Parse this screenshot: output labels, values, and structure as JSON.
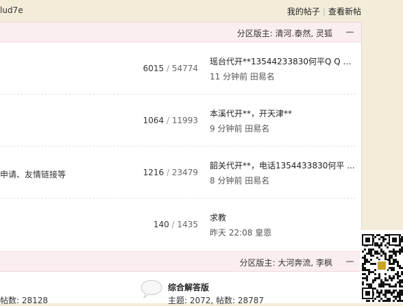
{
  "topbar": {
    "username": "lud7e",
    "my_posts": "我的帖子",
    "separator": "|",
    "view_new": "查看新帖"
  },
  "category1": {
    "moderators": "分区版主: 清河.泰然, 灵狐"
  },
  "forums": [
    {
      "desc": "",
      "threads": "6015",
      "slash": "/",
      "posts": "54774",
      "last_title": "瑶台代开**13544233830何平Q Q 1 ...",
      "last_time": "11 分钟前",
      "last_user": "田易名"
    },
    {
      "desc": "",
      "threads": "1064",
      "slash": "/",
      "posts": "11993",
      "last_title": "本溪代开**，开天津**",
      "last_time": "9 分钟前",
      "last_user": "田易名"
    },
    {
      "desc": "申请、友情链接等",
      "threads": "1216",
      "slash": "/",
      "posts": "23479",
      "last_title": "韶关代开**，电话1354433830何平 ...",
      "last_time": "8 分钟前",
      "last_user": "田易名"
    },
    {
      "desc": "",
      "threads": "140",
      "slash": "/",
      "posts": "1435",
      "last_title": "求教",
      "last_time": "昨天 22:08",
      "last_user": "皇恩"
    }
  ],
  "category2": {
    "moderators": "分区版主: 大河奔流, 李枫"
  },
  "forum2": {
    "left_count": "帖数: 28128",
    "name": "综合解答版",
    "count": "主题: 2072, 帖数: 28787"
  },
  "colors": {
    "page_bg": "#f3ecd9",
    "category_bg": "#fbeef0",
    "text": "#333333"
  }
}
